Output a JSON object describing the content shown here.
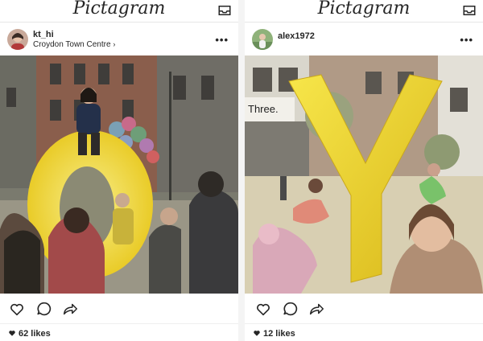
{
  "app": {
    "logo_text": "Pictagram"
  },
  "posts": [
    {
      "username": "kt_hi",
      "location": "Croydon Town Centre",
      "likes": "62 likes",
      "photo_letter": "O",
      "photo_subject": "yellow-letter-o-sculpture"
    },
    {
      "username": "alex1972",
      "location": "",
      "likes": "12 likes",
      "photo_letter": "Y",
      "photo_subject": "yellow-letter-y-sculpture",
      "storefront_sign": "Three."
    }
  ],
  "icons": {
    "inbox": "inbox-icon",
    "like": "heart-outline-icon",
    "comment": "speech-bubble-icon",
    "share": "share-arrow-icon",
    "likes_heart": "heart-filled-icon",
    "more": "more-options-icon"
  },
  "colors": {
    "sculpture_yellow": "#f2dc2e",
    "text": "#262626",
    "separator": "#efefef"
  }
}
